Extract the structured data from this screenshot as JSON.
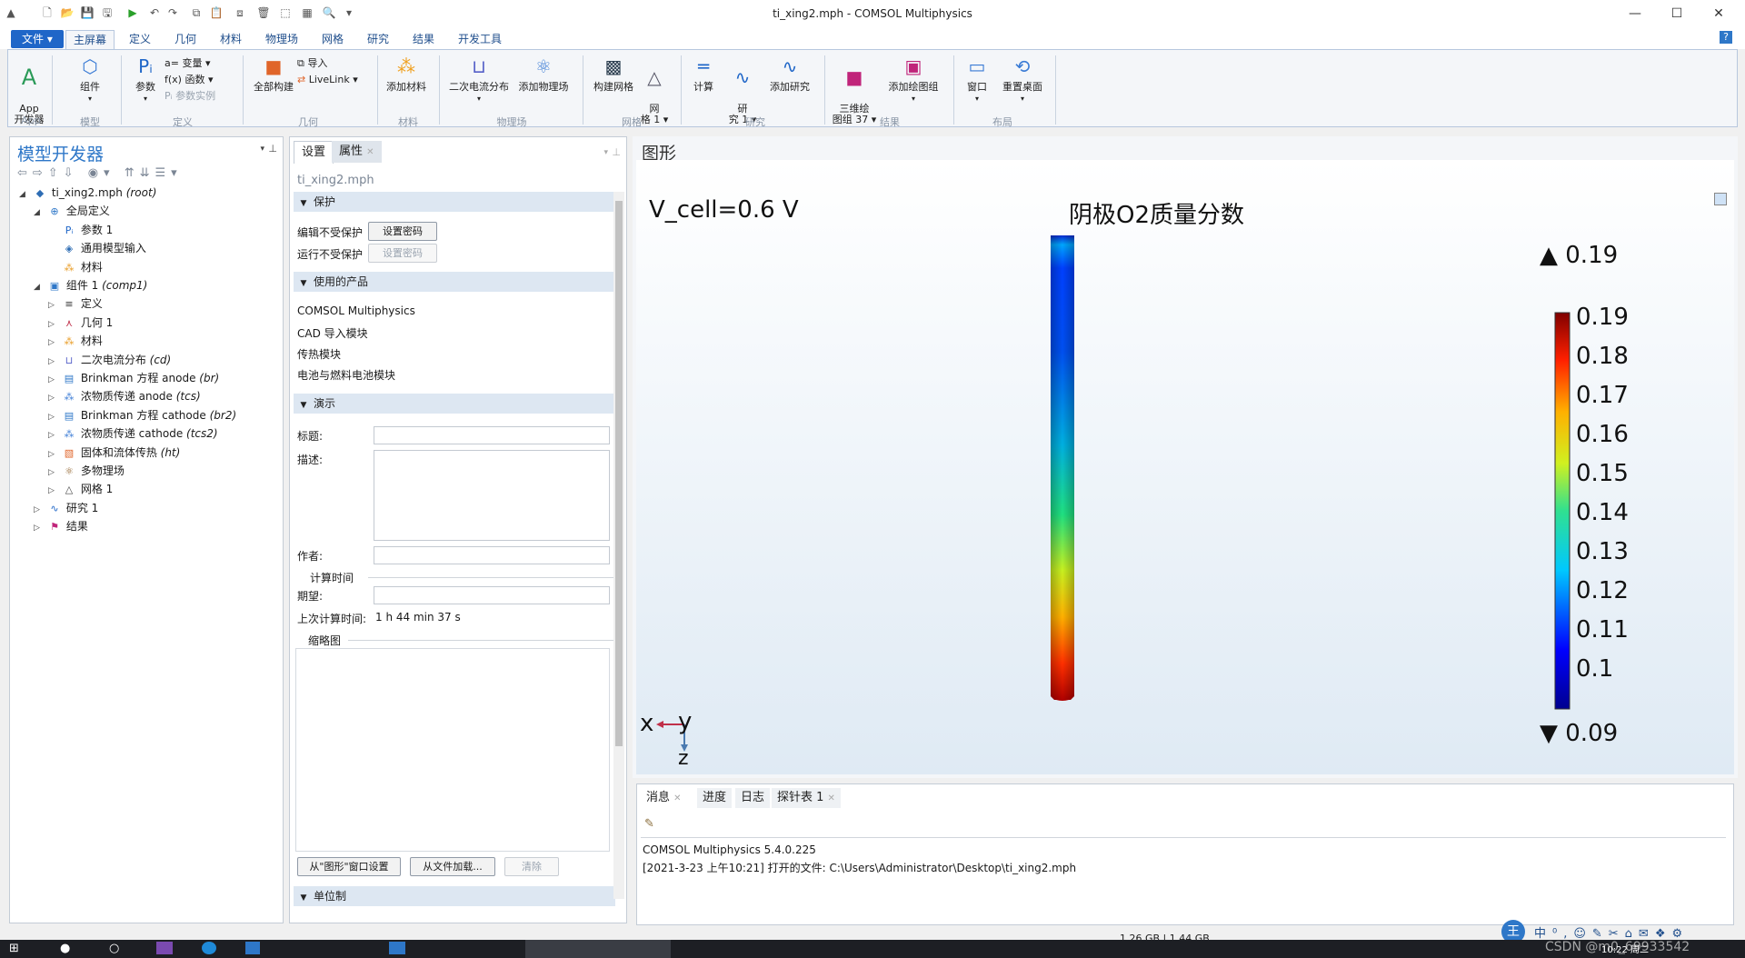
{
  "window": {
    "title": "ti_xing2.mph - COMSOL Multiphysics",
    "minimize": "—",
    "maximize": "☐",
    "close": "✕"
  },
  "ribbon_tabs": [
    "文件 ▾",
    "主屏幕",
    "定义",
    "几何",
    "材料",
    "物理场",
    "网格",
    "研究",
    "结果",
    "开发工具"
  ],
  "help": "?",
  "ribbon": {
    "app_btn": "App\n开发器",
    "component_btn": "组件",
    "param_btn": "参数",
    "variable": "a= 变量 ▾",
    "function": "f(x) 函数 ▾",
    "param_instance": "Pᵢ 参数实例",
    "build_all": "全部构建",
    "import": "导入",
    "livelink": "LiveLink ▾",
    "add_material": "添加材料",
    "secondary_current": "二次电流分布",
    "add_physics": "添加物理场",
    "build_mesh": "构建网格",
    "mesh1": "网\n格 1 ▾",
    "compute": "计算",
    "study1": "研\n究 1 ▾",
    "add_study": "添加研究",
    "plot3d": "三维绘\n图组 37 ▾",
    "add_plotgroup": "添加绘图组",
    "window_btn": "窗口",
    "reset_desktop": "重置桌面",
    "groups": [
      "App",
      "模型",
      "定义",
      "几何",
      "材料",
      "物理场",
      "网格",
      "研究",
      "结果",
      "布局"
    ]
  },
  "model_builder": {
    "title": "模型开发器",
    "tree": [
      {
        "label": "ti_xing2.mph",
        "tag": "(root)"
      },
      {
        "label": "全局定义",
        "tag": ""
      },
      {
        "label": "参数 1",
        "tag": ""
      },
      {
        "label": "通用模型输入",
        "tag": ""
      },
      {
        "label": "材料",
        "tag": ""
      },
      {
        "label": "组件 1",
        "tag": "(comp1)"
      },
      {
        "label": "定义",
        "tag": ""
      },
      {
        "label": "几何 1",
        "tag": ""
      },
      {
        "label": "材料",
        "tag": ""
      },
      {
        "label": "二次电流分布",
        "tag": "(cd)"
      },
      {
        "label": "Brinkman 方程 anode",
        "tag": "(br)"
      },
      {
        "label": "浓物质传递 anode",
        "tag": "(tcs)"
      },
      {
        "label": "Brinkman 方程  cathode",
        "tag": "(br2)"
      },
      {
        "label": "浓物质传递 cathode",
        "tag": "(tcs2)"
      },
      {
        "label": "固体和流体传热",
        "tag": "(ht)"
      },
      {
        "label": "多物理场",
        "tag": ""
      },
      {
        "label": "网格 1",
        "tag": ""
      },
      {
        "label": "研究 1",
        "tag": ""
      },
      {
        "label": "结果",
        "tag": ""
      }
    ]
  },
  "settings": {
    "tab_settings": "设置",
    "tab_properties": "属性",
    "filename": "ti_xing2.mph",
    "sec_protect": "保护",
    "edit_unprotected": "编辑不受保护",
    "run_unprotected": "运行不受保护",
    "set_password": "设置密码",
    "sec_products": "使用的产品",
    "products": [
      "COMSOL Multiphysics",
      "CAD 导入模块",
      "传热模块",
      "电池与燃料电池模块"
    ],
    "sec_presentation": "演示",
    "title_label": "标题:",
    "desc_label": "描述:",
    "author_label": "作者:",
    "compute_time": "计算时间",
    "expected_label": "期望:",
    "last_compute_label": "上次计算时间:",
    "last_compute_value": "1 h 44 min 37 s",
    "thumbnail": "缩略图",
    "from_graphics": "从\"图形\"窗口设置",
    "from_file": "从文件加载...",
    "clear": "清除",
    "sec_units": "单位制"
  },
  "graphics": {
    "title": "图形",
    "vcell": "V_cell=0.6 V",
    "plot_title": "阴极O2质量分数",
    "max_label": "▲ 0.19",
    "min_label": "▼ 0.09",
    "colorbar_ticks": [
      "0.19",
      "0.18",
      "0.17",
      "0.16",
      "0.15",
      "0.14",
      "0.13",
      "0.12",
      "0.11",
      "0.1"
    ],
    "axis_x": "x",
    "axis_y": "y",
    "axis_z": "z"
  },
  "messages": {
    "tabs": [
      "消息",
      "进度",
      "日志",
      "探针表 1"
    ],
    "lines": [
      "COMSOL Multiphysics 5.4.0.225",
      "[2021-3-23 上午10:21] 打开的文件: C:\\Users\\Administrator\\Desktop\\ti_xing2.mph"
    ]
  },
  "status": {
    "memory": "1.26 GB | 1.44 GB"
  },
  "taskbar": {
    "clock": "10:22 周二",
    "watermark": "CSDN @m0_69933542"
  }
}
